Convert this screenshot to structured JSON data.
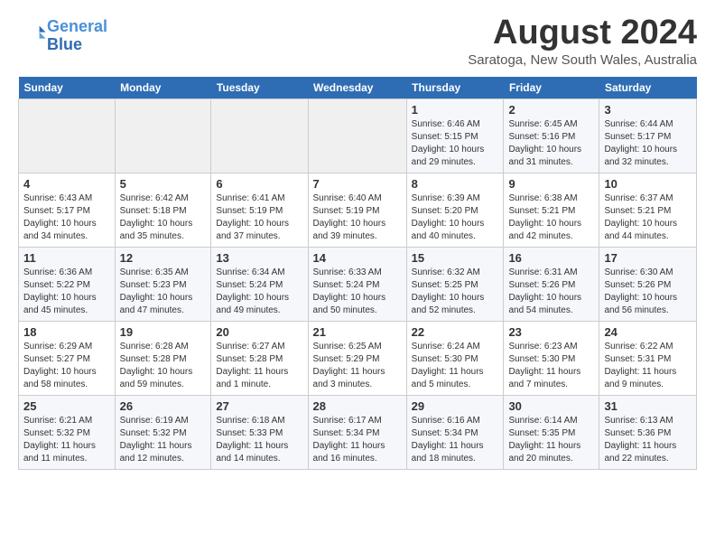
{
  "logo": {
    "line1": "General",
    "line2": "Blue"
  },
  "title": "August 2024",
  "location": "Saratoga, New South Wales, Australia",
  "days_of_week": [
    "Sunday",
    "Monday",
    "Tuesday",
    "Wednesday",
    "Thursday",
    "Friday",
    "Saturday"
  ],
  "weeks": [
    [
      {
        "day": "",
        "info": ""
      },
      {
        "day": "",
        "info": ""
      },
      {
        "day": "",
        "info": ""
      },
      {
        "day": "",
        "info": ""
      },
      {
        "day": "1",
        "info": "Sunrise: 6:46 AM\nSunset: 5:15 PM\nDaylight: 10 hours\nand 29 minutes."
      },
      {
        "day": "2",
        "info": "Sunrise: 6:45 AM\nSunset: 5:16 PM\nDaylight: 10 hours\nand 31 minutes."
      },
      {
        "day": "3",
        "info": "Sunrise: 6:44 AM\nSunset: 5:17 PM\nDaylight: 10 hours\nand 32 minutes."
      }
    ],
    [
      {
        "day": "4",
        "info": "Sunrise: 6:43 AM\nSunset: 5:17 PM\nDaylight: 10 hours\nand 34 minutes."
      },
      {
        "day": "5",
        "info": "Sunrise: 6:42 AM\nSunset: 5:18 PM\nDaylight: 10 hours\nand 35 minutes."
      },
      {
        "day": "6",
        "info": "Sunrise: 6:41 AM\nSunset: 5:19 PM\nDaylight: 10 hours\nand 37 minutes."
      },
      {
        "day": "7",
        "info": "Sunrise: 6:40 AM\nSunset: 5:19 PM\nDaylight: 10 hours\nand 39 minutes."
      },
      {
        "day": "8",
        "info": "Sunrise: 6:39 AM\nSunset: 5:20 PM\nDaylight: 10 hours\nand 40 minutes."
      },
      {
        "day": "9",
        "info": "Sunrise: 6:38 AM\nSunset: 5:21 PM\nDaylight: 10 hours\nand 42 minutes."
      },
      {
        "day": "10",
        "info": "Sunrise: 6:37 AM\nSunset: 5:21 PM\nDaylight: 10 hours\nand 44 minutes."
      }
    ],
    [
      {
        "day": "11",
        "info": "Sunrise: 6:36 AM\nSunset: 5:22 PM\nDaylight: 10 hours\nand 45 minutes."
      },
      {
        "day": "12",
        "info": "Sunrise: 6:35 AM\nSunset: 5:23 PM\nDaylight: 10 hours\nand 47 minutes."
      },
      {
        "day": "13",
        "info": "Sunrise: 6:34 AM\nSunset: 5:24 PM\nDaylight: 10 hours\nand 49 minutes."
      },
      {
        "day": "14",
        "info": "Sunrise: 6:33 AM\nSunset: 5:24 PM\nDaylight: 10 hours\nand 50 minutes."
      },
      {
        "day": "15",
        "info": "Sunrise: 6:32 AM\nSunset: 5:25 PM\nDaylight: 10 hours\nand 52 minutes."
      },
      {
        "day": "16",
        "info": "Sunrise: 6:31 AM\nSunset: 5:26 PM\nDaylight: 10 hours\nand 54 minutes."
      },
      {
        "day": "17",
        "info": "Sunrise: 6:30 AM\nSunset: 5:26 PM\nDaylight: 10 hours\nand 56 minutes."
      }
    ],
    [
      {
        "day": "18",
        "info": "Sunrise: 6:29 AM\nSunset: 5:27 PM\nDaylight: 10 hours\nand 58 minutes."
      },
      {
        "day": "19",
        "info": "Sunrise: 6:28 AM\nSunset: 5:28 PM\nDaylight: 10 hours\nand 59 minutes."
      },
      {
        "day": "20",
        "info": "Sunrise: 6:27 AM\nSunset: 5:28 PM\nDaylight: 11 hours\nand 1 minute."
      },
      {
        "day": "21",
        "info": "Sunrise: 6:25 AM\nSunset: 5:29 PM\nDaylight: 11 hours\nand 3 minutes."
      },
      {
        "day": "22",
        "info": "Sunrise: 6:24 AM\nSunset: 5:30 PM\nDaylight: 11 hours\nand 5 minutes."
      },
      {
        "day": "23",
        "info": "Sunrise: 6:23 AM\nSunset: 5:30 PM\nDaylight: 11 hours\nand 7 minutes."
      },
      {
        "day": "24",
        "info": "Sunrise: 6:22 AM\nSunset: 5:31 PM\nDaylight: 11 hours\nand 9 minutes."
      }
    ],
    [
      {
        "day": "25",
        "info": "Sunrise: 6:21 AM\nSunset: 5:32 PM\nDaylight: 11 hours\nand 11 minutes."
      },
      {
        "day": "26",
        "info": "Sunrise: 6:19 AM\nSunset: 5:32 PM\nDaylight: 11 hours\nand 12 minutes."
      },
      {
        "day": "27",
        "info": "Sunrise: 6:18 AM\nSunset: 5:33 PM\nDaylight: 11 hours\nand 14 minutes."
      },
      {
        "day": "28",
        "info": "Sunrise: 6:17 AM\nSunset: 5:34 PM\nDaylight: 11 hours\nand 16 minutes."
      },
      {
        "day": "29",
        "info": "Sunrise: 6:16 AM\nSunset: 5:34 PM\nDaylight: 11 hours\nand 18 minutes."
      },
      {
        "day": "30",
        "info": "Sunrise: 6:14 AM\nSunset: 5:35 PM\nDaylight: 11 hours\nand 20 minutes."
      },
      {
        "day": "31",
        "info": "Sunrise: 6:13 AM\nSunset: 5:36 PM\nDaylight: 11 hours\nand 22 minutes."
      }
    ]
  ]
}
